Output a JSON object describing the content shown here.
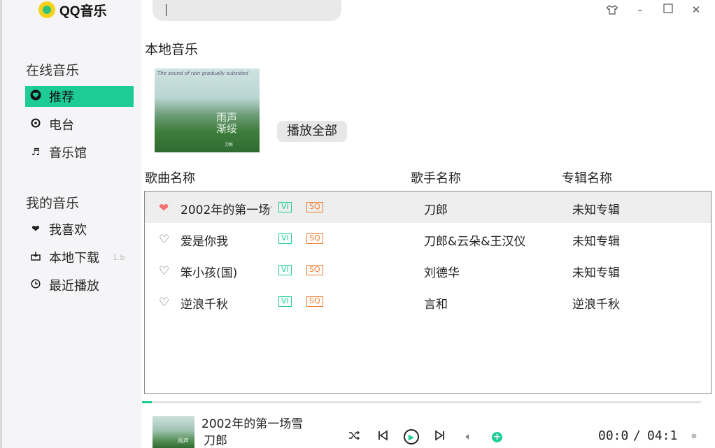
{
  "app": {
    "logo_text": "QQ音乐"
  },
  "search": {
    "value": ""
  },
  "window_controls": [
    "skin-icon",
    "minimize-icon",
    "maximize-icon",
    "close-icon"
  ],
  "sidebar": {
    "online_title": "在线音乐",
    "online_items": [
      {
        "label": "推荐",
        "icon": "heart-circle-icon",
        "active": true
      },
      {
        "label": "电台",
        "icon": "radio-icon",
        "active": false
      },
      {
        "label": "音乐馆",
        "icon": "music-note-icon",
        "active": false
      }
    ],
    "mine_title": "我的音乐",
    "mine_items": [
      {
        "label": "我喜欢",
        "icon": "heart-icon"
      },
      {
        "label": "本地下载",
        "icon": "download-icon"
      },
      {
        "label": "最近播放",
        "icon": "clock-icon"
      }
    ],
    "extra": "1.b"
  },
  "main": {
    "title": "本地音乐",
    "play_all": "播放全部",
    "cover": {
      "subtitle": "The sound of rain gradually subsided",
      "title_line1": "雨声",
      "title_line2": "渐绥",
      "author": "刀郎"
    },
    "columns": {
      "song": "歌曲名称",
      "singer": "歌手名称",
      "album": "专辑名称"
    },
    "tags": {
      "v": "VI",
      "sq": "SQ"
    },
    "songs": [
      {
        "title": "2002年的第一场雪",
        "singer": "刀郎",
        "album": "未知专辑",
        "liked": true,
        "selected": true
      },
      {
        "title": "爱是你我",
        "singer": "刀郎&云朵&王汉仪",
        "album": "未知专辑",
        "liked": false,
        "selected": false
      },
      {
        "title": "笨小孩(国)",
        "singer": "刘德华",
        "album": "未知专辑",
        "liked": false,
        "selected": false
      },
      {
        "title": "逆浪千秋",
        "singer": "言和",
        "album": "逆浪千秋",
        "liked": false,
        "selected": false
      }
    ]
  },
  "player": {
    "song_title": "2002年的第一场雪",
    "artist": "刀郎",
    "current_time": "00:0",
    "separator": "/",
    "total_time": "04:1",
    "progress_fraction": 0.018,
    "mini_cover_text": "雨声",
    "accent_color": "#1ecd96"
  }
}
